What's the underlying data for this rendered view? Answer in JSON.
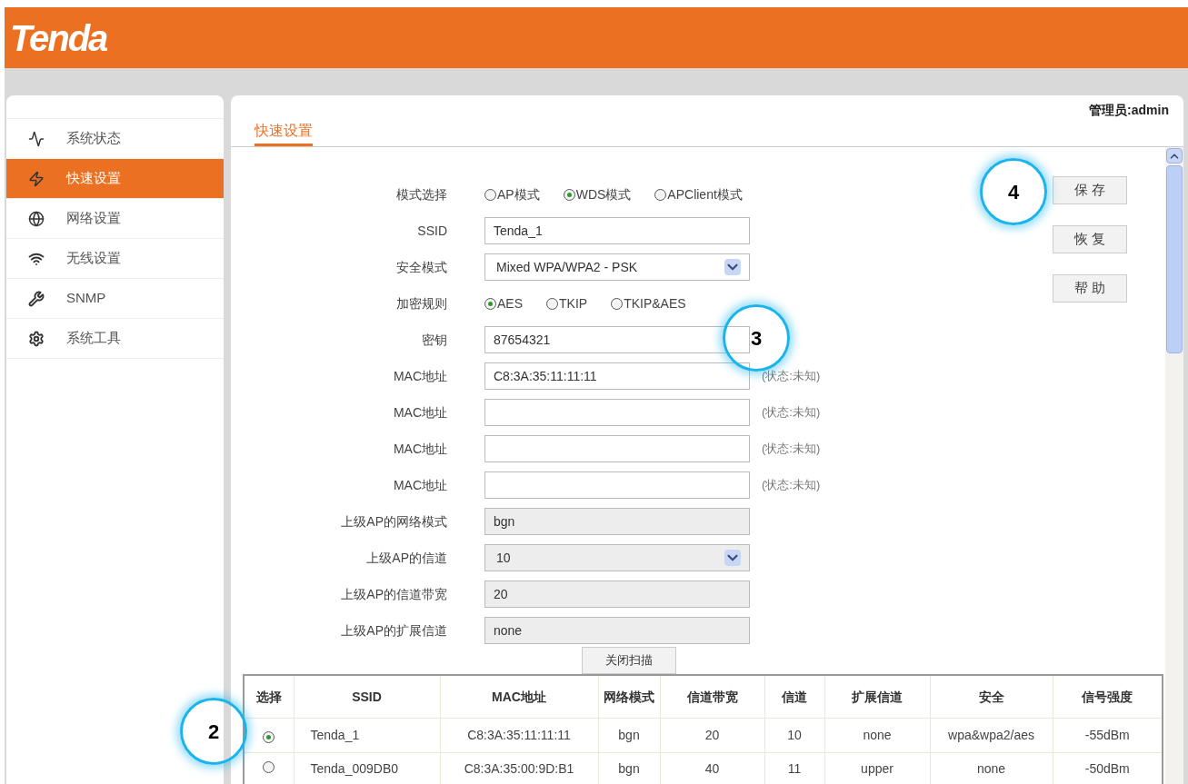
{
  "header": {
    "logo": "Tenda"
  },
  "sidebar": {
    "items": [
      {
        "label": "系统状态",
        "selected": false
      },
      {
        "label": "快速设置",
        "selected": true
      },
      {
        "label": "网络设置",
        "selected": false
      },
      {
        "label": "无线设置",
        "selected": false
      },
      {
        "label": "SNMP",
        "selected": false
      },
      {
        "label": "系统工具",
        "selected": false
      }
    ]
  },
  "user": "管理员:admin",
  "tab": {
    "label": "快速设置",
    "selected": true
  },
  "form": [
    {
      "kind": "radio",
      "label": "模式选择",
      "options": [
        {
          "label": "AP模式",
          "selected": false
        },
        {
          "label": "WDS模式",
          "selected": true
        },
        {
          "label": "APClient模式",
          "selected": false
        }
      ]
    },
    {
      "kind": "text",
      "label": "SSID",
      "value": "Tenda_1"
    },
    {
      "kind": "select",
      "label": "安全模式",
      "value": "Mixed WPA/WPA2 - PSK"
    },
    {
      "kind": "radio",
      "label": "加密规则",
      "options": [
        {
          "label": "AES",
          "selected": true
        },
        {
          "label": "TKIP",
          "selected": false
        },
        {
          "label": "TKIP&AES",
          "selected": false
        }
      ]
    },
    {
      "kind": "text",
      "label": "密钥",
      "value": "87654321"
    },
    {
      "kind": "text",
      "label": "MAC地址",
      "value": "C8:3A:35:11:11:11",
      "status": "(状态:未知)"
    },
    {
      "kind": "text",
      "label": "MAC地址",
      "status": "(状态:未知)"
    },
    {
      "kind": "text",
      "label": "MAC地址",
      "status": "(状态:未知)"
    },
    {
      "kind": "text",
      "label": "MAC地址",
      "status": "(状态:未知)"
    },
    {
      "kind": "readonly",
      "label": "上级AP的网络模式",
      "value": "bgn"
    },
    {
      "kind": "readonly-select",
      "label": "上级AP的信道",
      "value": "10"
    },
    {
      "kind": "readonly",
      "label": "上级AP的信道带宽",
      "value": "20"
    },
    {
      "kind": "readonly",
      "label": "上级AP的扩展信道",
      "value": "none"
    }
  ],
  "buttons": [
    "保 存",
    "恢 复",
    "帮 助"
  ],
  "scan_button": "关闭扫描",
  "table": {
    "columns": [
      "选择",
      "SSID",
      "MAC地址",
      "网络模式",
      "信道带宽",
      "信道",
      "扩展信道",
      "安全",
      "信号强度"
    ],
    "rows": [
      {
        "selected": true,
        "cells": [
          "",
          "Tenda_1",
          "C8:3A:35:11:11:11",
          "bgn",
          "20",
          "10",
          "none",
          "wpa&wpa2/aes",
          "-55dBm"
        ]
      },
      {
        "selected": false,
        "cells": [
          "",
          "Tenda_009DB0",
          "C8:3A:35:00:9D:B1",
          "bgn",
          "40",
          "11",
          "upper",
          "none",
          "-50dBm"
        ]
      }
    ]
  },
  "callouts": [
    {
      "label": "4"
    },
    {
      "label": "3"
    },
    {
      "label": "2"
    }
  ]
}
